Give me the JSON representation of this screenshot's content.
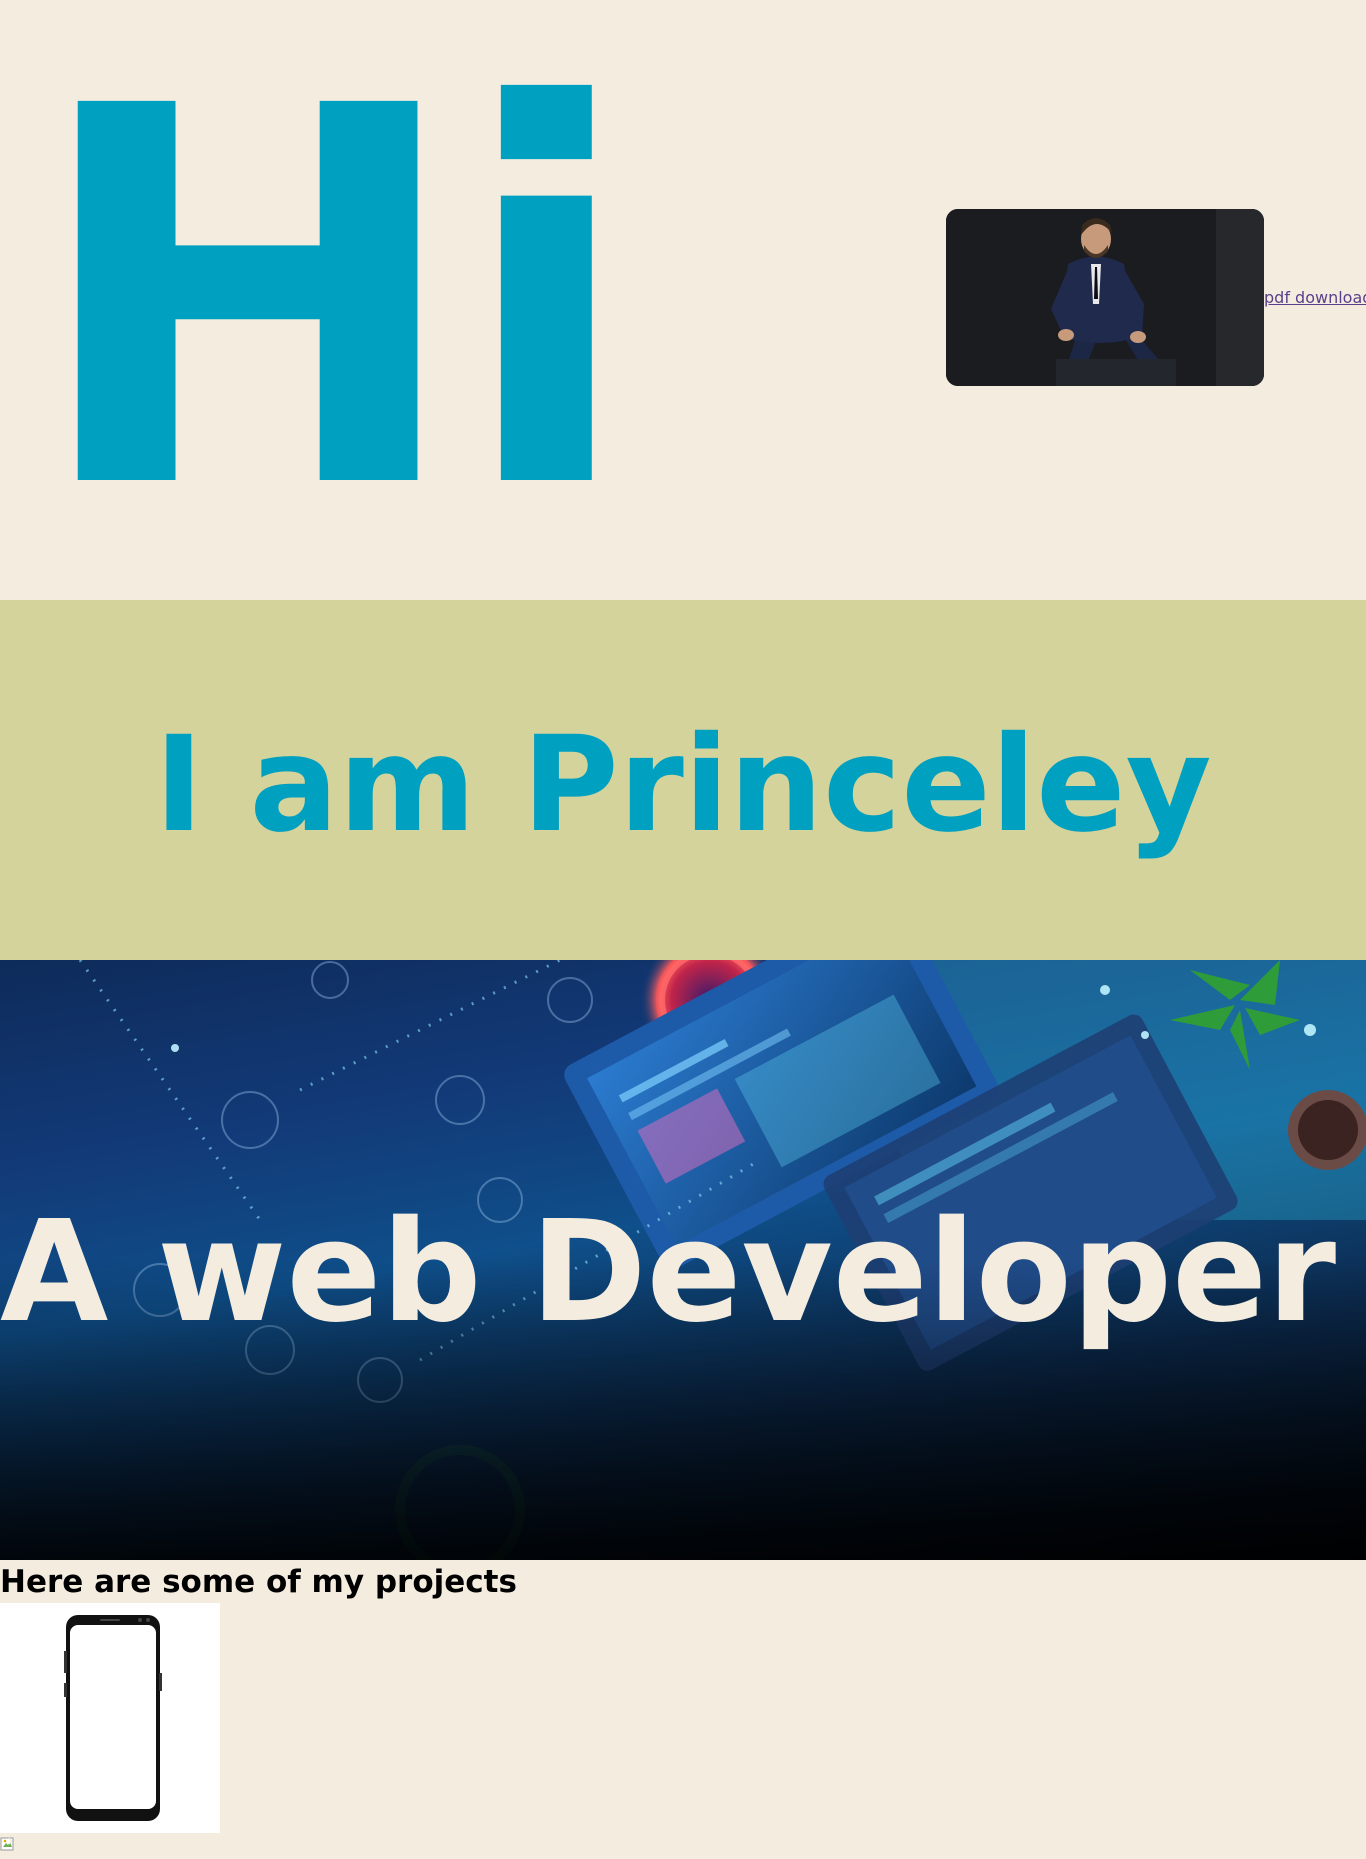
{
  "hero": {
    "greeting": "Hi",
    "portrait_icon": "portrait-photo",
    "pdf_link_label": "pdf download"
  },
  "intro": {
    "headline": "I am Princeley"
  },
  "banner": {
    "headline": "A web Developer",
    "background_icon": "tech-workspace-image"
  },
  "projects": {
    "heading": "Here are some of my projects",
    "items": [
      {
        "icon": "smartphone-mockup"
      }
    ],
    "broken_image_icon": "broken-image-icon"
  },
  "colors": {
    "page_bg": "#f3ecdf",
    "accent": "#00a0c0",
    "intro_bg": "#d4d39c",
    "link": "#5b3f8c"
  }
}
